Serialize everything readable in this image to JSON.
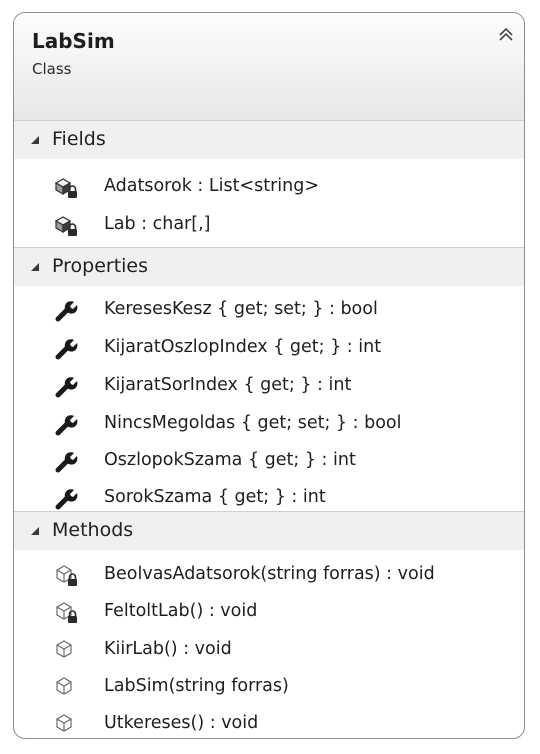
{
  "class_box": {
    "name": "LabSim",
    "kind": "Class",
    "collapse_icon": "double-chevron-up-icon"
  },
  "sections": {
    "fields": {
      "title": "Fields",
      "items": [
        {
          "label": "Adatsorok : List<string>",
          "icon": "private-field-icon"
        },
        {
          "label": "Lab : char[,]",
          "icon": "private-field-icon"
        }
      ]
    },
    "properties": {
      "title": "Properties",
      "items": [
        {
          "label": "KeresesKesz { get; set; } : bool",
          "icon": "wrench-icon"
        },
        {
          "label": "KijaratOszlopIndex { get; } : int",
          "icon": "wrench-icon"
        },
        {
          "label": "KijaratSorIndex { get; } : int",
          "icon": "wrench-icon"
        },
        {
          "label": "NincsMegoldas { get; set; } : bool",
          "icon": "wrench-icon"
        },
        {
          "label": "OszlopokSzama { get; } : int",
          "icon": "wrench-icon"
        },
        {
          "label": "SorokSzama { get; } : int",
          "icon": "wrench-icon"
        }
      ]
    },
    "methods": {
      "title": "Methods",
      "items": [
        {
          "label": "BeolvasAdatsorok(string forras) : void",
          "icon": "private-method-icon"
        },
        {
          "label": "FeltoltLab() : void",
          "icon": "private-method-icon"
        },
        {
          "label": "KiirLab() : void",
          "icon": "method-icon"
        },
        {
          "label": "LabSim(string forras)",
          "icon": "method-icon"
        },
        {
          "label": "Utkereses() : void",
          "icon": "method-icon"
        }
      ]
    }
  }
}
